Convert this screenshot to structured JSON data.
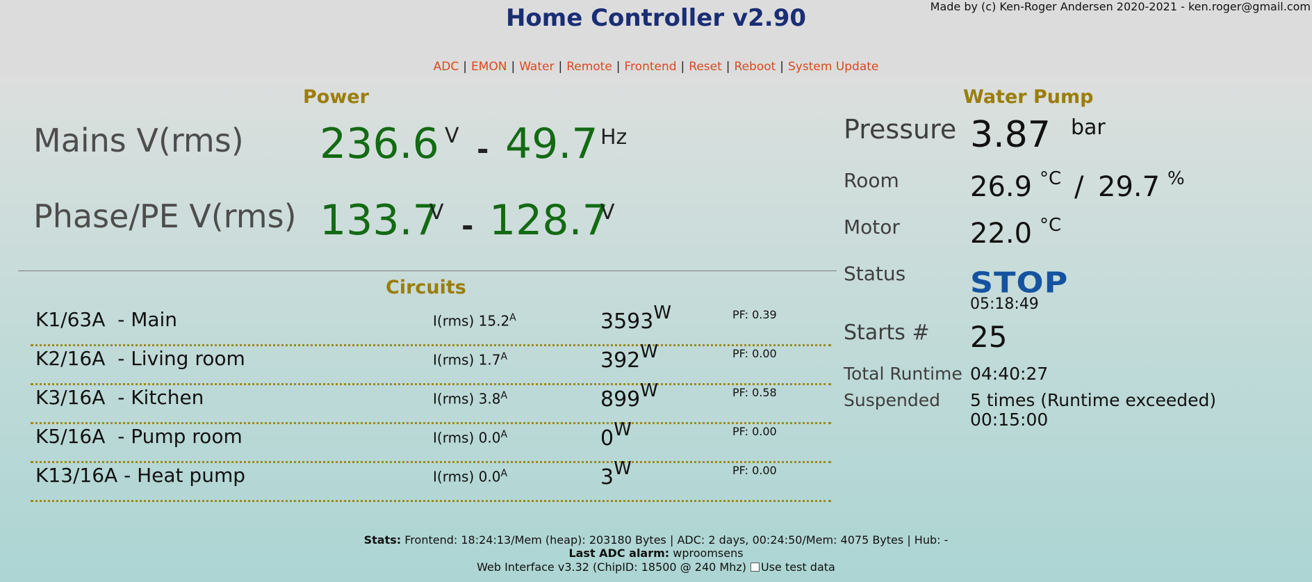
{
  "header": {
    "title": "Home Controller v2.90",
    "credit": "Made by (c) Ken-Roger Andersen 2020-2021 - ken.roger@gmail.com"
  },
  "nav": [
    "ADC",
    "EMON",
    "Water",
    "Remote",
    "Frontend",
    "Reset",
    "Reboot",
    "System Update"
  ],
  "power": {
    "title": "Power",
    "mains_label": "Mains V(rms)",
    "mains_voltage": "236.6",
    "mains_voltage_unit": "V",
    "mains_freq": "49.7",
    "mains_freq_unit": "Hz",
    "phase_label": "Phase/PE V(rms)",
    "phase_v1": "133.7",
    "phase_v1_unit": "V",
    "phase_v2": "128.7",
    "phase_v2_unit": "V",
    "separator": "-"
  },
  "circuits": {
    "title": "Circuits",
    "current_prefix": "I(rms) ",
    "current_unit": "A",
    "power_unit": "W",
    "rows": [
      {
        "name": "K1/63A  - Main",
        "current": "15.2",
        "power": "3593",
        "pf": "PF: 0.39"
      },
      {
        "name": "K2/16A  - Living room",
        "current": "1.7",
        "power": "392",
        "pf": "PF: 0.00"
      },
      {
        "name": "K3/16A  - Kitchen",
        "current": "3.8",
        "power": "899",
        "pf": "PF: 0.58"
      },
      {
        "name": "K5/16A  - Pump room",
        "current": "0.0",
        "power": "0",
        "pf": "PF: 0.00"
      },
      {
        "name": "K13/16A - Heat pump",
        "current": "0.0",
        "power": "3",
        "pf": "PF: 0.00"
      }
    ]
  },
  "water_pump": {
    "title": "Water Pump",
    "pressure_label": "Pressure",
    "pressure_value": "3.87",
    "pressure_unit": "bar",
    "room_label": "Room",
    "room_temp": "26.9",
    "room_temp_unit": "°C",
    "room_sep": "/",
    "room_humidity": "29.7",
    "room_humidity_unit": "%",
    "motor_label": "Motor",
    "motor_temp": "22.0",
    "motor_temp_unit": "°C",
    "status_label": "Status",
    "status_value": "STOP",
    "status_color": "#1553a0",
    "status_time": "05:18:49",
    "starts_label": "Starts #",
    "starts_value": "25",
    "runtime_label": "Total Runtime",
    "runtime_value": "04:40:27",
    "suspended_label": "Suspended",
    "suspended_value": "5 times (Runtime exceeded)",
    "suspended_time": "00:15:00"
  },
  "footer": {
    "stats_label": "Stats:",
    "stats_text": " Frontend: 18:24:13/Mem (heap): 203180 Bytes | ADC: 2 days, 00:24:50/Mem: 4075 Bytes | Hub: -",
    "alarm_label": "Last ADC alarm:",
    "alarm_text": " wproomsens",
    "web_text": "Web Interface v3.32 (ChipID: 18500 @ 240 Mhz)",
    "test_data_label": "Use test data"
  }
}
